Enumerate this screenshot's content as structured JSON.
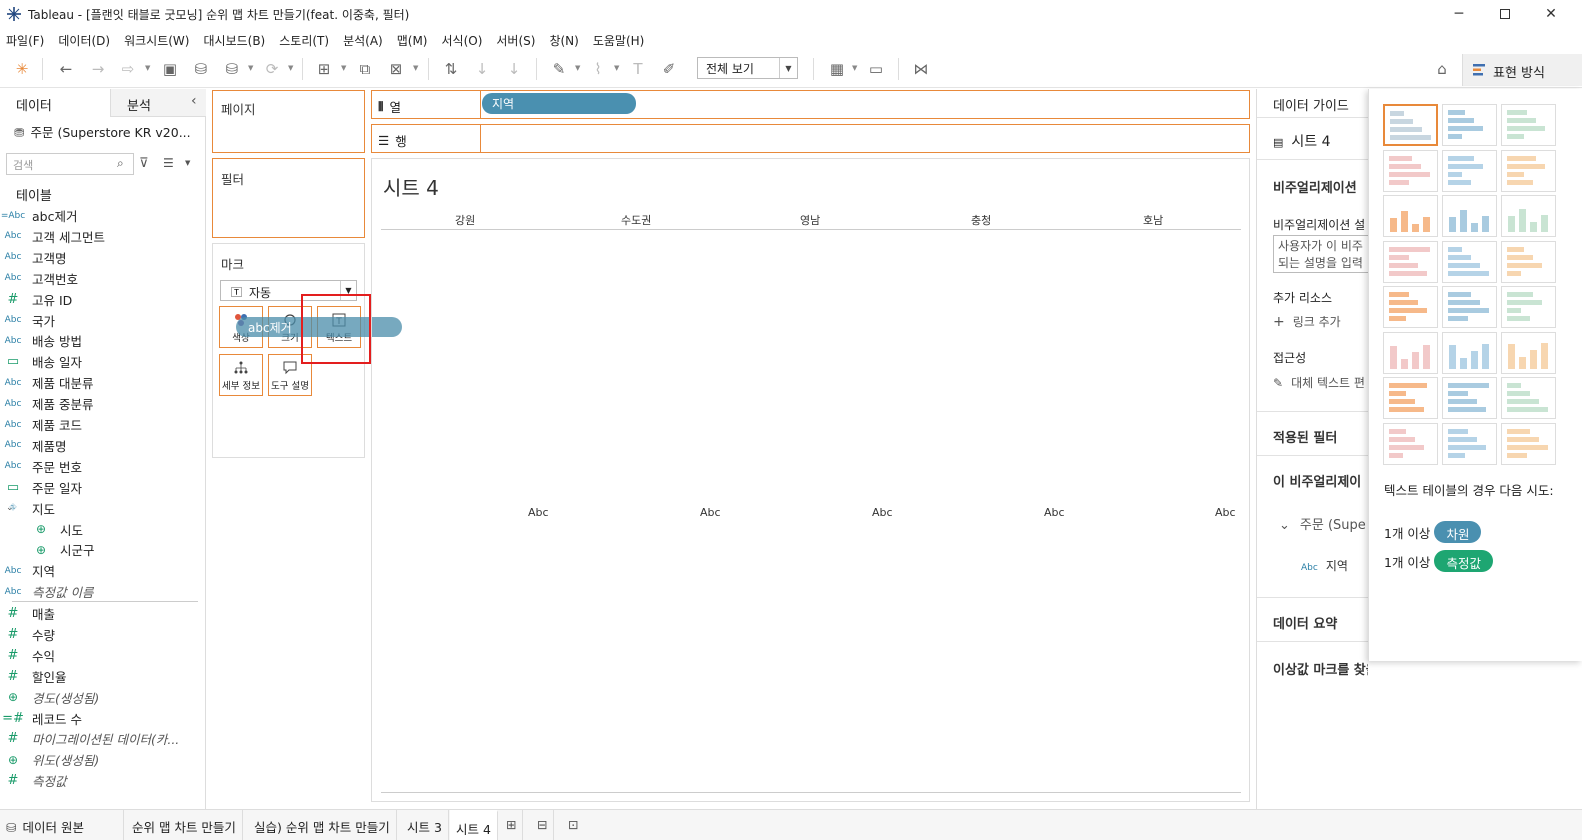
{
  "window": {
    "title": "Tableau - [플랜잇 태블로 굿모닝] 순위 맵 차트 만들기(feat. 이중축, 필터)"
  },
  "menu": [
    "파일(F)",
    "데이터(D)",
    "워크시트(W)",
    "대시보드(B)",
    "스토리(T)",
    "분석(A)",
    "맵(M)",
    "서식(O)",
    "서버(S)",
    "창(N)",
    "도움말(H)"
  ],
  "toolbar": {
    "view_select": "전체 보기",
    "show_me": "표현 방식"
  },
  "data_pane": {
    "tabs": [
      "데이터",
      "분석"
    ],
    "datasource": "주문 (Superstore KR v20...",
    "search_placeholder": "검색",
    "tables_header": "테이블",
    "fields": [
      {
        "icon": "=Abc",
        "name": "abc제거"
      },
      {
        "icon": "Abc",
        "name": "고객 세그먼트"
      },
      {
        "icon": "Abc",
        "name": "고객명"
      },
      {
        "icon": "Abc",
        "name": "고객번호"
      },
      {
        "icon": "#",
        "name": "고유 ID"
      },
      {
        "icon": "Abc",
        "name": "국가"
      },
      {
        "icon": "Abc",
        "name": "배송 방법"
      },
      {
        "icon": "date",
        "name": "배송 일자"
      },
      {
        "icon": "Abc",
        "name": "제품 대분류"
      },
      {
        "icon": "Abc",
        "name": "제품 중분류"
      },
      {
        "icon": "Abc",
        "name": "제품 코드"
      },
      {
        "icon": "Abc",
        "name": "제품명"
      },
      {
        "icon": "Abc",
        "name": "주문 번호"
      },
      {
        "icon": "date",
        "name": "주문 일자"
      },
      {
        "icon": "hier",
        "name": "지도"
      },
      {
        "icon": "geo",
        "name": "시도",
        "sub": true
      },
      {
        "icon": "geo",
        "name": "시군구",
        "sub": true
      },
      {
        "icon": "Abc",
        "name": "지역"
      },
      {
        "icon": "Abc",
        "name": "측정값 이름",
        "italic": true
      }
    ],
    "measures": [
      {
        "icon": "#",
        "name": "매출"
      },
      {
        "icon": "#",
        "name": "수량"
      },
      {
        "icon": "#",
        "name": "수익"
      },
      {
        "icon": "#",
        "name": "할인율"
      },
      {
        "icon": "geo",
        "name": "경도(생성됨)",
        "italic": true
      },
      {
        "icon": "=#",
        "name": "레코드 수"
      },
      {
        "icon": "#",
        "name": "마이그레이션된 데이터(카...",
        "italic": true
      },
      {
        "icon": "geo",
        "name": "위도(생성됨)",
        "italic": true
      },
      {
        "icon": "#",
        "name": "측정값",
        "italic": true
      }
    ]
  },
  "cards": {
    "pages": "페이지",
    "filters": "필터",
    "marks": "마크",
    "mark_type": "자동",
    "mark_buttons": [
      "색상",
      "크기",
      "텍스트",
      "세부 정보",
      "도구 설명"
    ],
    "drag_pill": "abc제거"
  },
  "shelves": {
    "columns_label": "열",
    "rows_label": "행",
    "columns_pill": "지역"
  },
  "view": {
    "sheet_title": "시트 4",
    "headers": [
      "강원",
      "수도권",
      "영남",
      "충청",
      "호남"
    ],
    "cells": [
      "Abc",
      "Abc",
      "Abc",
      "Abc",
      "Abc"
    ]
  },
  "guide": {
    "tab": "데이터 가이드",
    "sheet": "시트 4",
    "viz_header": "비주얼리제이션",
    "viz_desc_label": "비주얼리제이션 설",
    "desc_line1": "사용자가 이 비주",
    "desc_line2": "되는 설명을 입력",
    "resources": "추가 리소스",
    "add_link": "링크 추가",
    "accessibility": "접근성",
    "alt_text": "대체 텍스트 편",
    "applied_filters": "적용된 필터",
    "this_viz": "이 비주얼리제이",
    "source": "주문 (Supe",
    "field_icon": "Abc",
    "field": "지역",
    "data_summary": "데이터 요약",
    "outliers": "이상값 마크를 찾을 수 없음"
  },
  "show_me": {
    "hint": "텍스트 테이블의 경우 다음 시도:",
    "req1_prefix": "1개 이상",
    "req1_pill": "차원",
    "req2_prefix": "1개 이상",
    "req2_pill": "측정값",
    "colors": {
      "dimension": "#4a90b0",
      "measure": "#1ea672"
    }
  },
  "tabs_bar": {
    "datasource": "데이터 원본",
    "sheets": [
      "순위 맵 차트 만들기",
      "실습) 순위 맵 차트 만들기",
      "시트 3",
      "시트 4"
    ]
  },
  "colors": {
    "accent_orange": "#e8893a",
    "pill_blue": "#4a90b0",
    "highlight_red": "#e31e1e"
  }
}
